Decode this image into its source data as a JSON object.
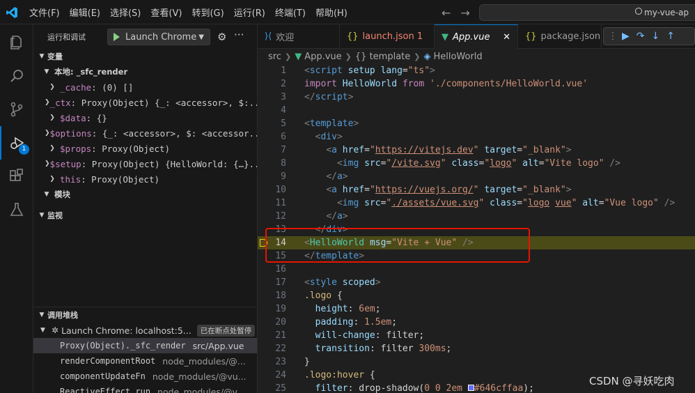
{
  "titlebar": {
    "menu": [
      "文件(F)",
      "编辑(E)",
      "选择(S)",
      "查看(V)",
      "转到(G)",
      "运行(R)",
      "终端(T)",
      "帮助(H)"
    ],
    "back_icon": "←",
    "forward_icon": "→",
    "search_text": "my-vue-ap"
  },
  "sidebar": {
    "title": "运行和调试",
    "launch_config": "Launch Chrome",
    "variables_header": "变量",
    "local_scope": "本地: _sfc_render",
    "variables": [
      {
        "name": "_cache",
        "value": ": (0) []"
      },
      {
        "name": "_ctx",
        "value": ": Proxy(Object) {_: <accessor>, $:..."
      },
      {
        "name": "$data",
        "value": ": {}"
      },
      {
        "name": "$options",
        "value": ": {_: <accessor>, $: <accessor..."
      },
      {
        "name": "$props",
        "value": ": Proxy(Object)"
      },
      {
        "name": "$setup",
        "value": ": Proxy(Object) {HelloWorld: {…}..."
      },
      {
        "name": "this",
        "value": ": Proxy(Object)"
      }
    ],
    "module_scope": "模块",
    "watch_header": "监视",
    "callstack_header": "调用堆栈",
    "session_name": "Launch Chrome: localhost:5...",
    "paused_badge": "已在断点处暂停",
    "frames": [
      {
        "fn": "Proxy(Object)._sfc_render",
        "path": "src/App.vue"
      },
      {
        "fn": "renderComponentRoot",
        "path": "node_modules/@..."
      },
      {
        "fn": "componentUpdateFn",
        "path": "node_modules/@vu..."
      },
      {
        "fn": "ReactiveEffect.run",
        "path": "node_modules/@v..."
      }
    ]
  },
  "tabs": [
    {
      "label": "欢迎",
      "icon": "vscode-icon"
    },
    {
      "label": "launch.json 1",
      "icon": "json-icon"
    },
    {
      "label": "App.vue",
      "icon": "vue-icon"
    },
    {
      "label": "package.json",
      "icon": "json-icon"
    }
  ],
  "breadcrumb": {
    "folder": "src",
    "file": "App.vue",
    "node1": "{} template",
    "node2": "HelloWorld"
  },
  "current_line": 14,
  "watermark": "CSDN @寻妖吃肉",
  "colors": {
    "accent": "#0078d4",
    "highlight": "#4b4b18",
    "redbox": "#e51400",
    "breakpoint": "#ffcc00"
  }
}
